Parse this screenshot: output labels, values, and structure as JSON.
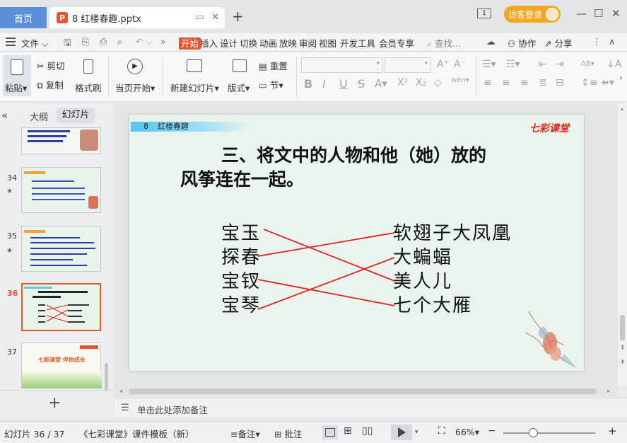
{
  "titlebar": {
    "home_tab": "首页",
    "file_tab": "8 红楼春趣.pptx",
    "visitor_login": "访客登录",
    "new_tab": "+",
    "window_number": "1"
  },
  "menubar": {
    "file_menu": "文件",
    "tabs": [
      "开始",
      "插入",
      "设计",
      "切换",
      "动画",
      "放映",
      "审阅",
      "视图",
      "开发工具",
      "会员专享"
    ],
    "search_placeholder": "查找...",
    "collaborate": "协作",
    "share": "分享",
    "more": "»"
  },
  "ribbon": {
    "paste": "粘贴",
    "cut": "剪切",
    "copy": "复制",
    "format_painter": "格式刷",
    "from_current": "当页开始",
    "new_slide": "新建幻灯片",
    "layout": "版式",
    "reset": "重置",
    "section": "节",
    "wen": "wén"
  },
  "leftpanel": {
    "tab_outline": "大纲",
    "tab_slides": "幻灯片",
    "slide_numbers": [
      "34",
      "35",
      "36",
      "37"
    ],
    "add_slide": "+",
    "thumb37_text": "七彩课堂  伴你成长"
  },
  "slide": {
    "header_num": "8",
    "header_title": "红楼春趣",
    "logo": "七彩课堂",
    "title_line1": "三、将文中的人物和他（她）放的",
    "title_line2": "风筝连在一起。",
    "left_items": [
      "宝玉",
      "探春",
      "宝钗",
      "宝琴"
    ],
    "right_items": [
      "软翅子大凤凰",
      "大蝙蝠",
      "美人儿",
      "七个大雁"
    ],
    "line_color": "#e02020"
  },
  "notes": {
    "placeholder": "单击此处添加备注"
  },
  "statusbar": {
    "slide_counter": "幻灯片 36 / 37",
    "template": "《七彩课堂》课件模板（新）",
    "notes_btn": "备注",
    "comment_btn": "批注",
    "zoom": "66%"
  },
  "colors": {
    "accent": "#e8542e",
    "home_blue": "#5b8fd8",
    "visitor_orange": "#f5a623"
  }
}
